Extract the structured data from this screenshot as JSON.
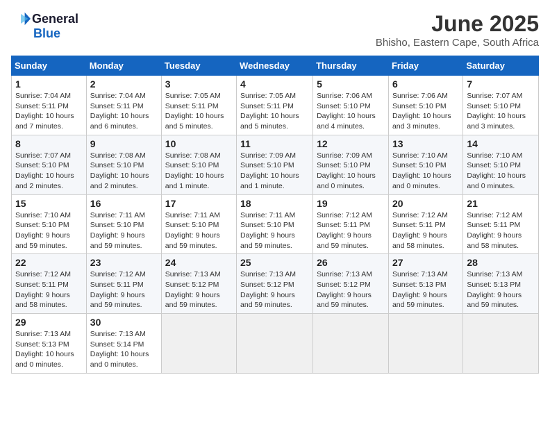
{
  "header": {
    "logo_general": "General",
    "logo_blue": "Blue",
    "month_title": "June 2025",
    "location": "Bhisho, Eastern Cape, South Africa"
  },
  "weekdays": [
    "Sunday",
    "Monday",
    "Tuesday",
    "Wednesday",
    "Thursday",
    "Friday",
    "Saturday"
  ],
  "weeks": [
    [
      {
        "day": "1",
        "sunrise": "7:04 AM",
        "sunset": "5:11 PM",
        "daylight": "10 hours and 7 minutes."
      },
      {
        "day": "2",
        "sunrise": "7:04 AM",
        "sunset": "5:11 PM",
        "daylight": "10 hours and 6 minutes."
      },
      {
        "day": "3",
        "sunrise": "7:05 AM",
        "sunset": "5:11 PM",
        "daylight": "10 hours and 5 minutes."
      },
      {
        "day": "4",
        "sunrise": "7:05 AM",
        "sunset": "5:11 PM",
        "daylight": "10 hours and 5 minutes."
      },
      {
        "day": "5",
        "sunrise": "7:06 AM",
        "sunset": "5:10 PM",
        "daylight": "10 hours and 4 minutes."
      },
      {
        "day": "6",
        "sunrise": "7:06 AM",
        "sunset": "5:10 PM",
        "daylight": "10 hours and 3 minutes."
      },
      {
        "day": "7",
        "sunrise": "7:07 AM",
        "sunset": "5:10 PM",
        "daylight": "10 hours and 3 minutes."
      }
    ],
    [
      {
        "day": "8",
        "sunrise": "7:07 AM",
        "sunset": "5:10 PM",
        "daylight": "10 hours and 2 minutes."
      },
      {
        "day": "9",
        "sunrise": "7:08 AM",
        "sunset": "5:10 PM",
        "daylight": "10 hours and 2 minutes."
      },
      {
        "day": "10",
        "sunrise": "7:08 AM",
        "sunset": "5:10 PM",
        "daylight": "10 hours and 1 minute."
      },
      {
        "day": "11",
        "sunrise": "7:09 AM",
        "sunset": "5:10 PM",
        "daylight": "10 hours and 1 minute."
      },
      {
        "day": "12",
        "sunrise": "7:09 AM",
        "sunset": "5:10 PM",
        "daylight": "10 hours and 0 minutes."
      },
      {
        "day": "13",
        "sunrise": "7:10 AM",
        "sunset": "5:10 PM",
        "daylight": "10 hours and 0 minutes."
      },
      {
        "day": "14",
        "sunrise": "7:10 AM",
        "sunset": "5:10 PM",
        "daylight": "10 hours and 0 minutes."
      }
    ],
    [
      {
        "day": "15",
        "sunrise": "7:10 AM",
        "sunset": "5:10 PM",
        "daylight": "9 hours and 59 minutes."
      },
      {
        "day": "16",
        "sunrise": "7:11 AM",
        "sunset": "5:10 PM",
        "daylight": "9 hours and 59 minutes."
      },
      {
        "day": "17",
        "sunrise": "7:11 AM",
        "sunset": "5:10 PM",
        "daylight": "9 hours and 59 minutes."
      },
      {
        "day": "18",
        "sunrise": "7:11 AM",
        "sunset": "5:10 PM",
        "daylight": "9 hours and 59 minutes."
      },
      {
        "day": "19",
        "sunrise": "7:12 AM",
        "sunset": "5:11 PM",
        "daylight": "9 hours and 59 minutes."
      },
      {
        "day": "20",
        "sunrise": "7:12 AM",
        "sunset": "5:11 PM",
        "daylight": "9 hours and 58 minutes."
      },
      {
        "day": "21",
        "sunrise": "7:12 AM",
        "sunset": "5:11 PM",
        "daylight": "9 hours and 58 minutes."
      }
    ],
    [
      {
        "day": "22",
        "sunrise": "7:12 AM",
        "sunset": "5:11 PM",
        "daylight": "9 hours and 58 minutes."
      },
      {
        "day": "23",
        "sunrise": "7:12 AM",
        "sunset": "5:11 PM",
        "daylight": "9 hours and 59 minutes."
      },
      {
        "day": "24",
        "sunrise": "7:13 AM",
        "sunset": "5:12 PM",
        "daylight": "9 hours and 59 minutes."
      },
      {
        "day": "25",
        "sunrise": "7:13 AM",
        "sunset": "5:12 PM",
        "daylight": "9 hours and 59 minutes."
      },
      {
        "day": "26",
        "sunrise": "7:13 AM",
        "sunset": "5:12 PM",
        "daylight": "9 hours and 59 minutes."
      },
      {
        "day": "27",
        "sunrise": "7:13 AM",
        "sunset": "5:13 PM",
        "daylight": "9 hours and 59 minutes."
      },
      {
        "day": "28",
        "sunrise": "7:13 AM",
        "sunset": "5:13 PM",
        "daylight": "9 hours and 59 minutes."
      }
    ],
    [
      {
        "day": "29",
        "sunrise": "7:13 AM",
        "sunset": "5:13 PM",
        "daylight": "10 hours and 0 minutes."
      },
      {
        "day": "30",
        "sunrise": "7:13 AM",
        "sunset": "5:14 PM",
        "daylight": "10 hours and 0 minutes."
      },
      null,
      null,
      null,
      null,
      null
    ]
  ],
  "labels": {
    "sunrise_prefix": "Sunrise: ",
    "sunset_prefix": "Sunset: ",
    "daylight_prefix": "Daylight: "
  }
}
